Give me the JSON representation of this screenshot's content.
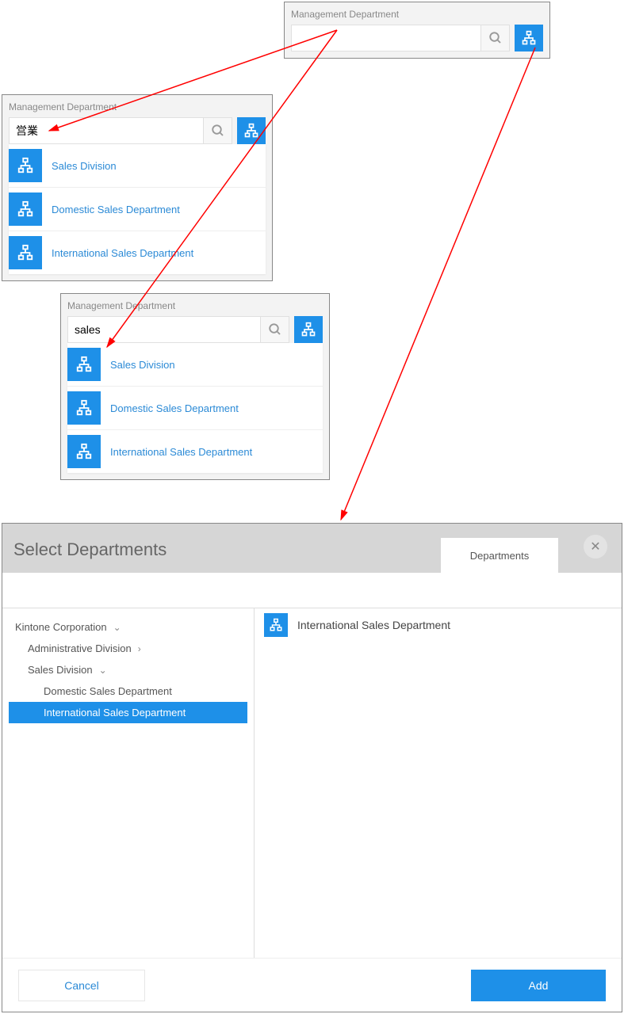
{
  "panelA": {
    "label": "Management Department",
    "input_value": ""
  },
  "panelB": {
    "label": "Management Department",
    "input_value": "営業",
    "suggestions": [
      "Sales Division",
      "Domestic Sales Department",
      "International Sales Department"
    ]
  },
  "panelC": {
    "label": "Management Department",
    "input_value": "sales",
    "suggestions": [
      "Sales Division",
      "Domestic Sales Department",
      "International Sales Department"
    ]
  },
  "modal": {
    "title": "Select Departments",
    "tab_label": "Departments",
    "tree": {
      "root": "Kintone Corporation",
      "nodes": [
        {
          "label": "Administrative Division",
          "expand": "right"
        },
        {
          "label": "Sales Division",
          "expand": "down"
        }
      ],
      "leaf1": "Domestic Sales Department",
      "leaf2_selected": "International Sales Department"
    },
    "selected_item": "International Sales Department",
    "cancel_label": "Cancel",
    "add_label": "Add"
  }
}
